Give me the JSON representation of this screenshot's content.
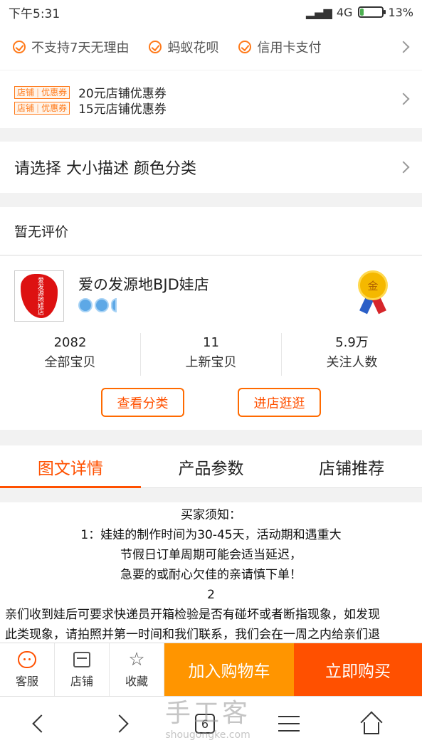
{
  "status_bar": {
    "time": "下午5:31",
    "network": "4G",
    "battery": "13%",
    "battery_level": 0.13
  },
  "services": [
    "不支持7天无理由",
    "蚂蚁花呗",
    "信用卡支付"
  ],
  "coupons": {
    "tag_left": "店铺",
    "tag_right": "优惠券",
    "items": [
      "20元店铺优惠券",
      "15元店铺优惠券"
    ]
  },
  "select_spec": "请选择 大小描述 颜色分类",
  "review_text": "暂无评价",
  "shop": {
    "logo_text": "爱发源地娃店",
    "name": "爱の发源地BJD娃店",
    "medal_text": "金",
    "stats": [
      {
        "value": "2082",
        "label": "全部宝贝"
      },
      {
        "value": "11",
        "label": "上新宝贝"
      },
      {
        "value": "5.9万",
        "label": "关注人数"
      }
    ],
    "buttons": {
      "category": "查看分类",
      "visit": "进店逛逛"
    }
  },
  "tabs": [
    "图文详情",
    "产品参数",
    "店铺推荐"
  ],
  "detail_lines": [
    "买家须知：",
    "1：娃娃的制作时间为30-45天，活动期和遇重大",
    "节假日订单周期可能会适当延迟，",
    "急要的或耐心欠佳的亲请慎下单！",
    "2",
    "亲们收到娃后可要求快递员开箱检验是否有碰坏或者断指现象，如发现",
    "此类现象，请拍照并第一时间和我们联系，我们会在一周之内给亲们退"
  ],
  "bottom_bar": {
    "service": "客服",
    "shop": "店铺",
    "favorite": "收藏",
    "add_cart": "加入购物车",
    "buy_now": "立即购买"
  },
  "nav": {
    "tab_count": "6"
  },
  "watermark": {
    "cn": "手工客",
    "url": "shougongke.com"
  },
  "colors": {
    "accent": "#ff5000",
    "cart": "#ff9500"
  }
}
